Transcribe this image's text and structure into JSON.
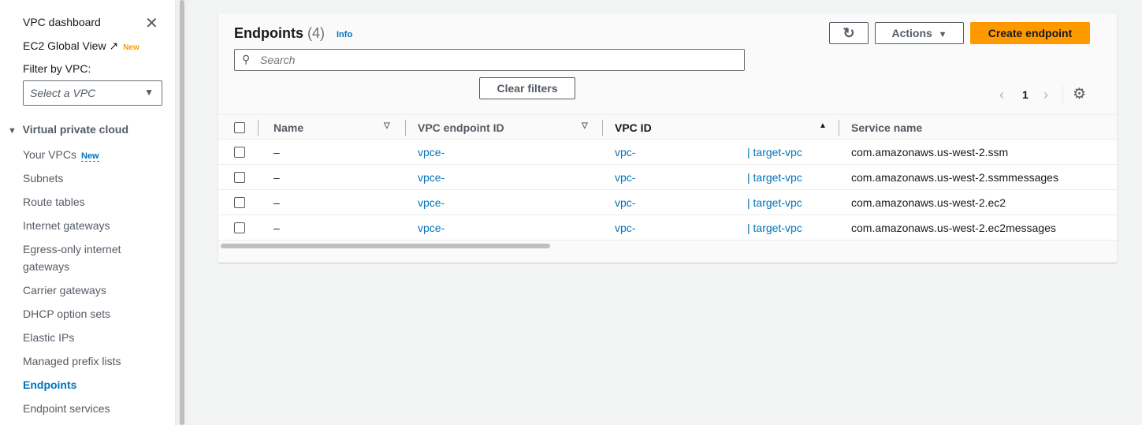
{
  "sidebar": {
    "dashboard": "VPC dashboard",
    "global_view": "EC2 Global View",
    "global_view_badge": "New",
    "filter_label": "Filter by VPC:",
    "filter_placeholder": "Select a VPC",
    "section": "Virtual private cloud",
    "items": [
      {
        "label": "Your VPCs",
        "badge": "New"
      },
      {
        "label": "Subnets"
      },
      {
        "label": "Route tables"
      },
      {
        "label": "Internet gateways"
      },
      {
        "label": "Egress-only internet gateways"
      },
      {
        "label": "Carrier gateways"
      },
      {
        "label": "DHCP option sets"
      },
      {
        "label": "Elastic IPs"
      },
      {
        "label": "Managed prefix lists"
      },
      {
        "label": "Endpoints"
      },
      {
        "label": "Endpoint services"
      }
    ]
  },
  "main": {
    "title": "Endpoints",
    "count": "(4)",
    "info": "Info",
    "search_placeholder": "Search",
    "clear_filters": "Clear filters",
    "actions": "Actions",
    "create": "Create endpoint",
    "page": "1",
    "columns": [
      "Name",
      "VPC endpoint ID",
      "VPC ID",
      "Service name"
    ],
    "rows": [
      {
        "name": "–",
        "endpoint_id": "vpce-",
        "vpc_id": "vpc-",
        "vpc_name": "| target-vpc",
        "service": "com.amazonaws.us-west-2.ssm"
      },
      {
        "name": "–",
        "endpoint_id": "vpce-",
        "vpc_id": "vpc-",
        "vpc_name": "| target-vpc",
        "service": "com.amazonaws.us-west-2.ssmmessages"
      },
      {
        "name": "–",
        "endpoint_id": "vpce-",
        "vpc_id": "vpc-",
        "vpc_name": "| target-vpc",
        "service": "com.amazonaws.us-west-2.ec2"
      },
      {
        "name": "–",
        "endpoint_id": "vpce-",
        "vpc_id": "vpc-",
        "vpc_name": "| target-vpc",
        "service": "com.amazonaws.us-west-2.ec2messages"
      }
    ]
  }
}
